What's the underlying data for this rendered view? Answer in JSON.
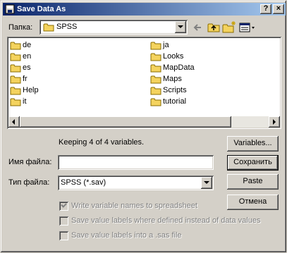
{
  "window": {
    "title": "Save Data As",
    "help_label": "?",
    "close_label": "×"
  },
  "location": {
    "label": "Папка:",
    "current": "SPSS"
  },
  "folders_left": [
    "de",
    "en",
    "es",
    "fr",
    "Help",
    "it"
  ],
  "folders_right": [
    "ja",
    "Looks",
    "MapData",
    "Maps",
    "Scripts",
    "tutorial"
  ],
  "status": "Keeping 4 of 4 variables.",
  "filename": {
    "label": "Имя файла:",
    "value": ""
  },
  "filetype": {
    "label": "Тип файла:",
    "value": "SPSS (*.sav)"
  },
  "buttons": {
    "variables": "Variables...",
    "save": "Сохранить",
    "paste": "Paste",
    "cancel": "Отмена"
  },
  "options": [
    {
      "label": "Write variable names to spreadsheet",
      "checked": true
    },
    {
      "label": "Save value labels where defined instead of data values",
      "checked": false
    },
    {
      "label": "Save value labels into a .sas file",
      "checked": false
    }
  ],
  "colors": {
    "title_start": "#0a246a",
    "title_end": "#a6caf0",
    "face": "#d4d0c8",
    "folder": "#f4d35e"
  }
}
